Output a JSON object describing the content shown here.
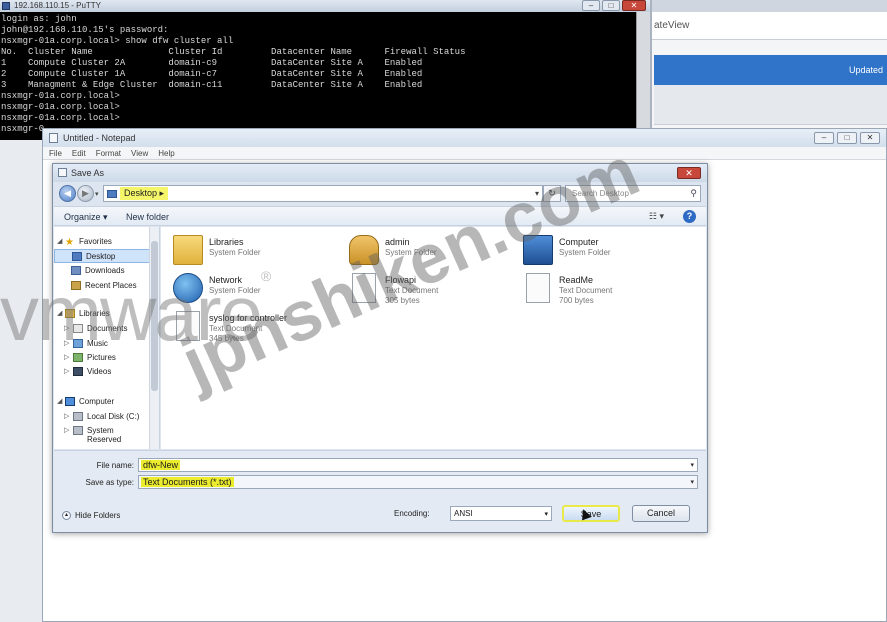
{
  "background_app": {
    "tab_text": "ateView",
    "banner_text": "Updated"
  },
  "putty": {
    "title": "192.168.110.15 - PuTTY",
    "lines": [
      "login as: john",
      "john@192.168.110.15's password:",
      "nsxmgr-01a.corp.local> show dfw cluster all",
      "No.  Cluster Name              Cluster Id         Datacenter Name      Firewall Status",
      "1    Compute Cluster 2A        domain-c9          DataCenter Site A    Enabled",
      "2    Compute Cluster 1A        domain-c7          DataCenter Site A    Enabled",
      "3    Managment & Edge Cluster  domain-c11         DataCenter Site A    Enabled",
      "nsxmgr-01a.corp.local>",
      "nsxmgr-01a.corp.local>",
      "nsxmgr-01a.corp.local>",
      "nsxmgr-0"
    ]
  },
  "notepad": {
    "title": "Untitled - Notepad",
    "menu": [
      "File",
      "Edit",
      "Format",
      "View",
      "Help"
    ]
  },
  "dialog": {
    "title": "Save As",
    "address": "Desktop",
    "search_placeholder": "Search Desktop",
    "organize": "Organize ▾",
    "new_folder": "New folder",
    "nav": {
      "favorites": "Favorites",
      "desktop": "Desktop",
      "downloads": "Downloads",
      "recent": "Recent Places",
      "libraries": "Libraries",
      "documents": "Documents",
      "music": "Music",
      "pictures": "Pictures",
      "videos": "Videos",
      "computer": "Computer",
      "local_disk": "Local Disk (C:)",
      "system_reserved": "System Reserved"
    },
    "files": [
      {
        "name": "Libraries",
        "type": "System Folder",
        "size": "",
        "icon": "folder-icon"
      },
      {
        "name": "admin",
        "type": "System Folder",
        "size": "",
        "icon": "user-folder-icon"
      },
      {
        "name": "Computer",
        "type": "System Folder",
        "size": "",
        "icon": "computer-icon"
      },
      {
        "name": "Network",
        "type": "System Folder",
        "size": "",
        "icon": "network-icon"
      },
      {
        "name": "Flowapi",
        "type": "Text Document",
        "size": "305 bytes",
        "icon": "text-document-icon"
      },
      {
        "name": "ReadMe",
        "type": "Text Document",
        "size": "700 bytes",
        "icon": "text-document-icon"
      },
      {
        "name": "syslog for controller",
        "type": "Text Document",
        "size": "345 bytes",
        "icon": "text-document-icon"
      }
    ],
    "file_name_label": "File name:",
    "file_name_value": "dfw-New",
    "save_type_label": "Save as type:",
    "save_type_value": "Text Documents (*.txt)",
    "hide_folders": "Hide Folders",
    "encoding_label": "Encoding:",
    "encoding_value": "ANSI",
    "save_button": "Save",
    "cancel_button": "Cancel"
  },
  "watermarks": {
    "vmware": "vmware",
    "site": "jpnshiken.com"
  }
}
